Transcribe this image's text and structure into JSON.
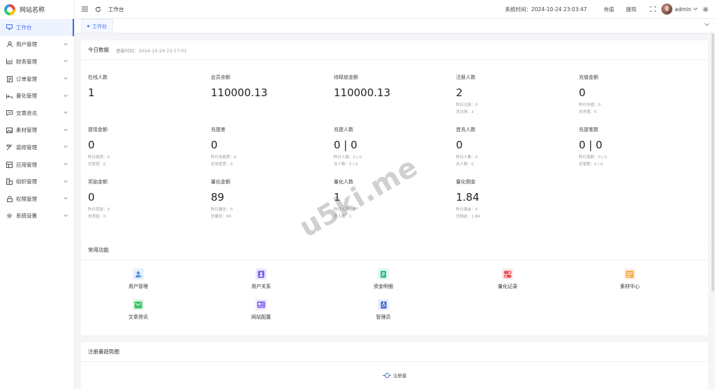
{
  "site": {
    "name": "网站名称"
  },
  "sidebar": {
    "items": [
      {
        "label": "工作台",
        "icon": "monitor-icon",
        "active": true,
        "chev": false
      },
      {
        "label": "用户管理",
        "icon": "user-icon",
        "chev": true
      },
      {
        "label": "财务管理",
        "icon": "chart-icon",
        "chev": true
      },
      {
        "label": "订单管理",
        "icon": "order-icon",
        "chev": true
      },
      {
        "label": "量化管理",
        "icon": "bed-icon",
        "chev": true
      },
      {
        "label": "文章资讯",
        "icon": "message-icon",
        "chev": true
      },
      {
        "label": "素材管理",
        "icon": "image-icon",
        "chev": true
      },
      {
        "label": "装修管理",
        "icon": "brush-icon",
        "chev": true
      },
      {
        "label": "应用管理",
        "icon": "app-icon",
        "chev": true
      },
      {
        "label": "组织管理",
        "icon": "org-icon",
        "chev": true
      },
      {
        "label": "权限管理",
        "icon": "lock-icon",
        "chev": true
      },
      {
        "label": "系统设置",
        "icon": "gear-icon",
        "chev": true
      }
    ]
  },
  "header": {
    "title": "工作台",
    "system_time": "系统时间：2024-10-24 23:03:47",
    "recharge": "充值",
    "withdraw": "提现",
    "user": "admin"
  },
  "tabs": [
    {
      "label": "工作台"
    }
  ],
  "today": {
    "title": "今日数据",
    "updated": "更新时间：2024-10-24 23:17:01",
    "stats": [
      {
        "title": "在线人数",
        "value": "1",
        "subs": []
      },
      {
        "title": "会员余额",
        "value": "110000.13",
        "subs": []
      },
      {
        "title": "待释放金额",
        "value": "110000.13",
        "subs": []
      },
      {
        "title": "注册人数",
        "value": "2",
        "subs": [
          "昨日注册：0",
          "总注册：2"
        ]
      },
      {
        "title": "充值金额",
        "value": "0",
        "subs": [
          "昨日充值：0",
          "总充值：0"
        ]
      },
      {
        "title": "提现金额",
        "value": "0",
        "subs": [
          "昨日提现：0",
          "总提现：0"
        ]
      },
      {
        "title": "充提差",
        "value": "0",
        "subs": [
          "昨日充提差：0",
          "总充提差：0"
        ]
      },
      {
        "title": "充提人数",
        "value": "0 | 0",
        "subs": [
          "昨日人数：0 | 0",
          "总人数：0 | 0"
        ]
      },
      {
        "title": "首充人数",
        "value": "0",
        "subs": [
          "昨日人数：0",
          "总人数：0"
        ]
      },
      {
        "title": "充提笔数",
        "value": "0 | 0",
        "subs": [
          "昨日笔数：0 | 0",
          "总笔数：0 | 0"
        ]
      },
      {
        "title": "奖励金额",
        "value": "0",
        "subs": [
          "昨日奖励：0",
          "总奖励：0"
        ]
      },
      {
        "title": "量化金额",
        "value": "89",
        "subs": [
          "昨日量化：0",
          "总量化：89"
        ]
      },
      {
        "title": "量化人数",
        "value": "1",
        "subs": [
          "昨日人数：0",
          "总人数：1"
        ]
      },
      {
        "title": "量化佣金",
        "value": "1.84",
        "subs": [
          "昨日佣金：0",
          "总佣金：1.84"
        ]
      }
    ]
  },
  "quick": {
    "title": "常用功能",
    "items": [
      {
        "label": "用户管理",
        "icon": "user-manage-icon",
        "color": "#e8f1fd"
      },
      {
        "label": "用户关系",
        "icon": "user-relation-icon",
        "color": "#ece9fb"
      },
      {
        "label": "资金明细",
        "icon": "fund-detail-icon",
        "color": "#e4f7ef"
      },
      {
        "label": "量化记录",
        "icon": "quant-record-icon",
        "color": "#fdeaea"
      },
      {
        "label": "素材中心",
        "icon": "material-center-icon",
        "color": "#fdf1e3"
      },
      {
        "label": "文章资讯",
        "icon": "article-icon",
        "color": "#e5f7ea"
      },
      {
        "label": "网站配置",
        "icon": "site-config-icon",
        "color": "#efe9fb"
      },
      {
        "label": "管理员",
        "icon": "admin-icon",
        "color": "#e8eefc"
      }
    ]
  },
  "trend": {
    "title": "注册量趋势图",
    "legend": "注册量"
  },
  "watermark": "u5ki.me"
}
